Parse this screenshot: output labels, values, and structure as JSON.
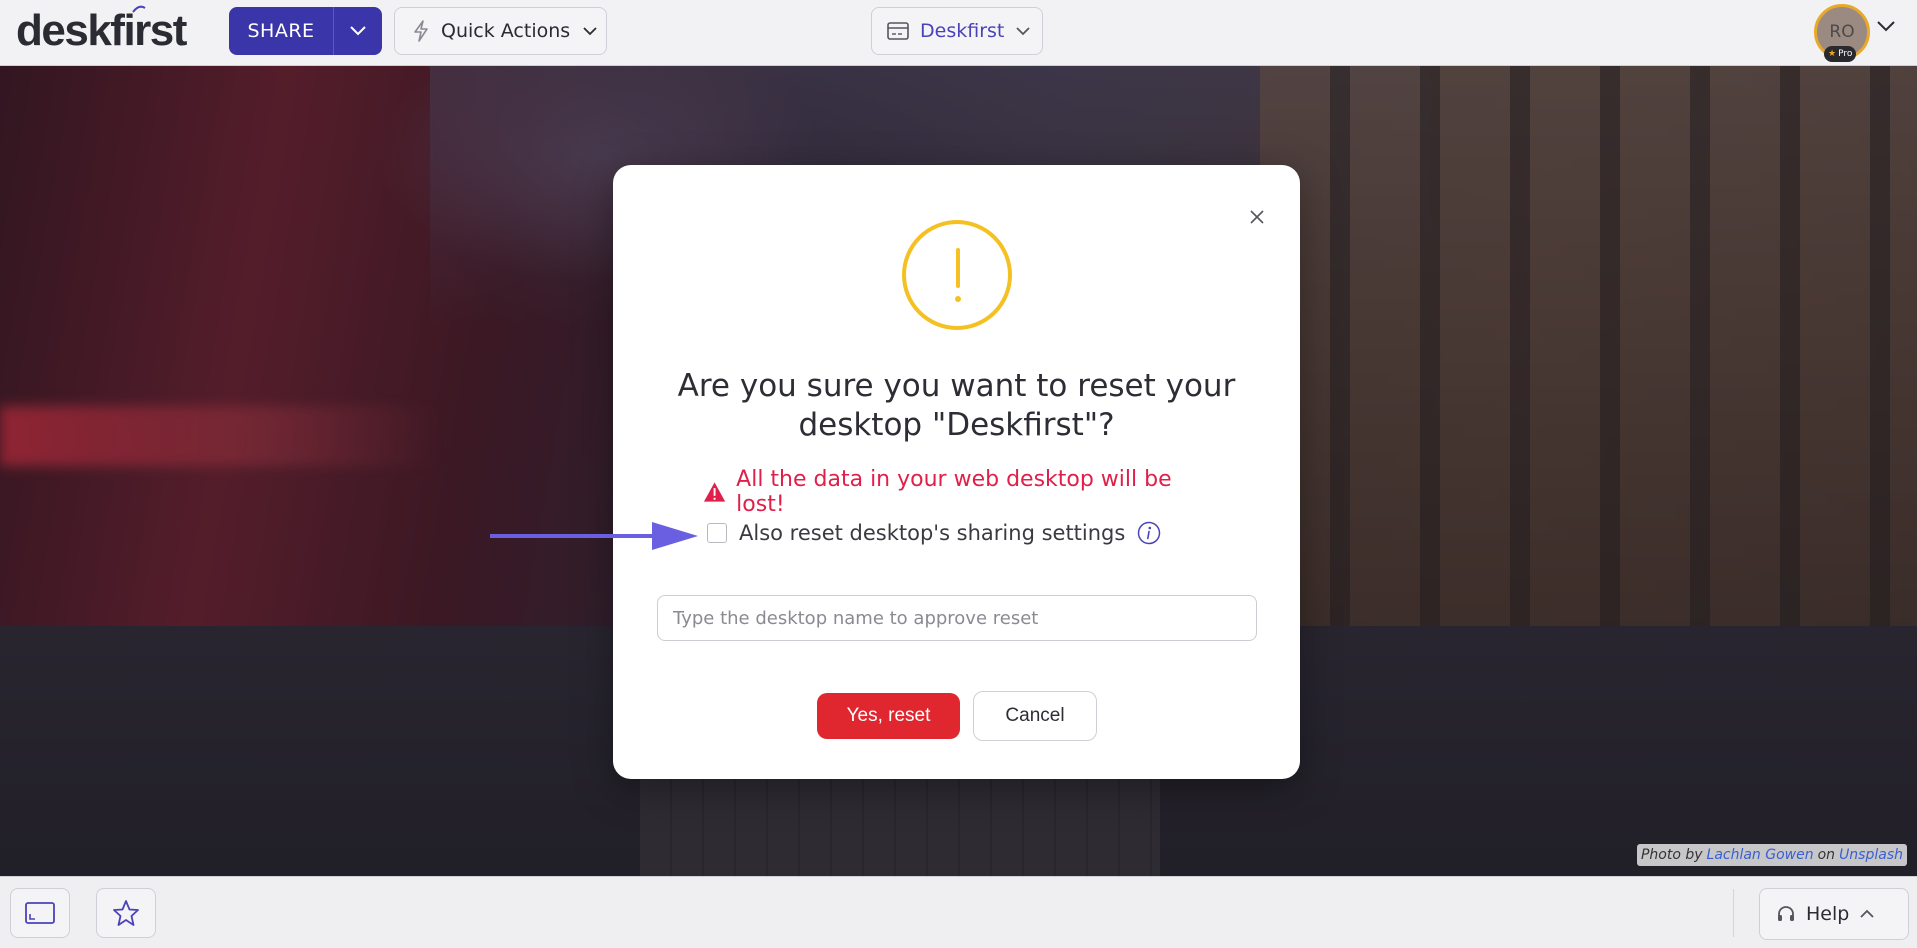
{
  "app": {
    "logo_text": "deskfirst",
    "share_label": "SHARE",
    "quick_actions_label": "Quick Actions",
    "desktop_name": "Deskfirst",
    "avatar_initials": "RO",
    "pro_badge": "Pro"
  },
  "background": {
    "credit_prefix": "Photo by",
    "credit_author": "Lachlan Gowen",
    "credit_on": "on",
    "credit_site": "Unsplash"
  },
  "modal": {
    "title": "Are you sure you want to reset your desktop \"Deskfirst\"?",
    "danger_text": "All the data in your web desktop will be lost!",
    "checkbox_label": "Also reset desktop's sharing settings",
    "checkbox_checked": false,
    "input_placeholder": "Type the desktop name to approve reset",
    "input_value": "",
    "confirm_label": "Yes, reset",
    "cancel_label": "Cancel"
  },
  "bottombar": {
    "help_label": "Help"
  },
  "icons": {
    "share_caret": "chevron-down-icon",
    "quick_actions": "lightning-icon",
    "desktop": "desktop-window-icon",
    "close": "close-icon",
    "warning": "exclamation-circle-icon",
    "danger": "warning-triangle-icon",
    "info": "info-icon",
    "fullscreen": "window-icon",
    "favorite": "star-icon",
    "help": "headset-icon"
  },
  "colors": {
    "brand": "#3a35a8",
    "accent": "#4a43b8",
    "warning": "#f5c021",
    "danger": "#e0204a",
    "confirm": "#e0272f"
  }
}
